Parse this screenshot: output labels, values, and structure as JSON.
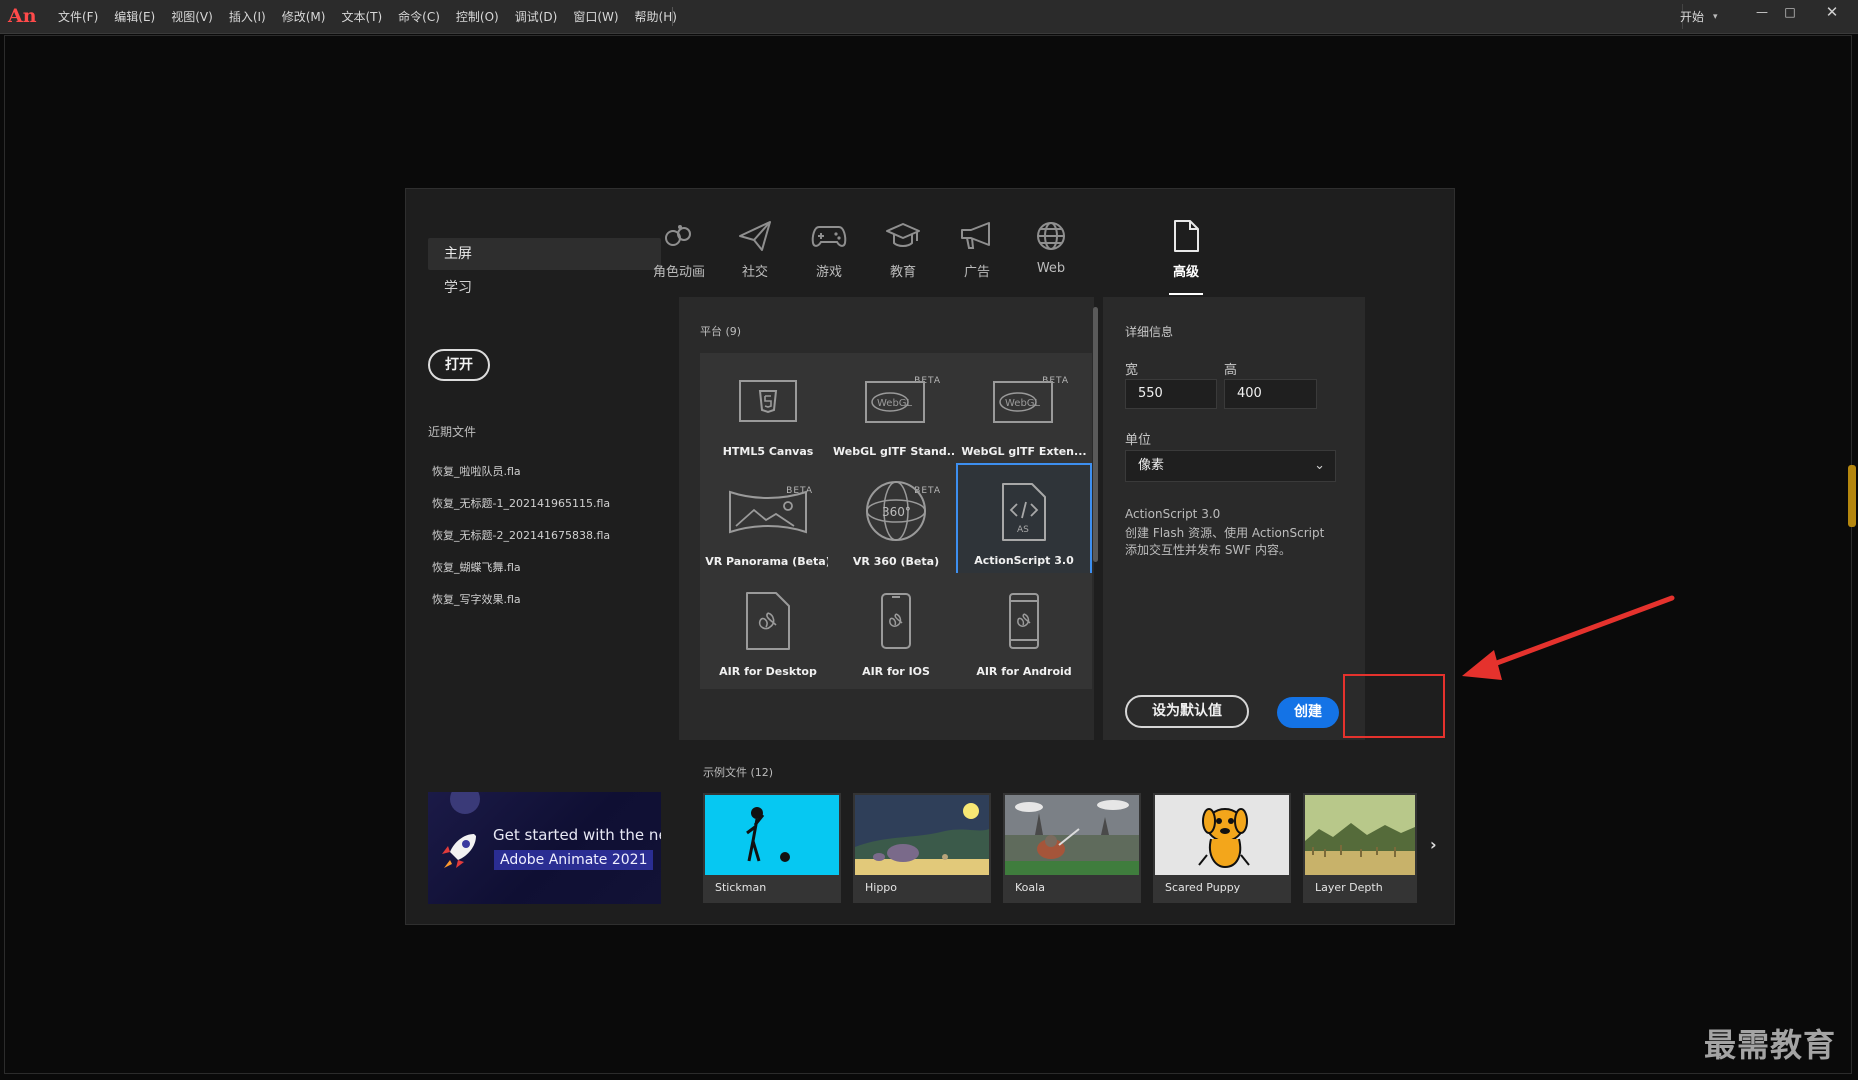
{
  "app": {
    "logo_text": "An",
    "menu": [
      "文件(F)",
      "编辑(E)",
      "视图(V)",
      "插入(I)",
      "修改(M)",
      "文本(T)",
      "命令(C)",
      "控制(O)",
      "调试(D)",
      "窗口(W)",
      "帮助(H)"
    ],
    "workspace_label": "开始",
    "window_buttons": {
      "minimize": "—",
      "maximize": "□",
      "close": "✕"
    }
  },
  "sidebar": {
    "home_label": "主屏",
    "learn_label": "学习",
    "open_label": "打开",
    "recent_title": "近期文件",
    "recent_files": [
      "恢复_啦啦队员.fla",
      "恢复_无标题-1_202141965115.fla",
      "恢复_无标题-2_202141675838.fla",
      "恢复_蝴蝶飞舞.fla",
      "恢复_写字效果.fla"
    ],
    "promo_line1": "Get started with the new",
    "promo_line2": "Adobe Animate 2021"
  },
  "categories": [
    {
      "label": "角色动画",
      "icon": "character-animation-icon",
      "active": false
    },
    {
      "label": "社交",
      "icon": "paper-plane-icon",
      "active": false
    },
    {
      "label": "游戏",
      "icon": "gamepad-icon",
      "active": false
    },
    {
      "label": "教育",
      "icon": "graduation-cap-icon",
      "active": false
    },
    {
      "label": "广告",
      "icon": "megaphone-icon",
      "active": false
    },
    {
      "label": "Web",
      "icon": "globe-icon",
      "active": false
    },
    {
      "label": "高级",
      "icon": "document-icon",
      "active": true
    }
  ],
  "platforms": {
    "heading": "平台 (9)",
    "items": [
      {
        "label": "HTML5 Canvas",
        "icon": "html5-icon",
        "beta": "",
        "selected": false
      },
      {
        "label": "WebGL glTF Stand...",
        "icon": "webgl-icon",
        "beta": "BETA",
        "selected": false
      },
      {
        "label": "WebGL glTF Exten...",
        "icon": "webgl-icon",
        "beta": "BETA",
        "selected": false
      },
      {
        "label": "VR Panorama (Beta)",
        "icon": "vr-panorama-icon",
        "beta": "BETA",
        "selected": false
      },
      {
        "label": "VR 360 (Beta)",
        "icon": "vr-360-icon",
        "beta": "BETA",
        "selected": false
      },
      {
        "label": "ActionScript 3.0",
        "icon": "actionscript-icon",
        "beta": "",
        "selected": true
      },
      {
        "label": "AIR for Desktop",
        "icon": "air-desktop-icon",
        "beta": "",
        "selected": false
      },
      {
        "label": "AIR for IOS",
        "icon": "air-ios-icon",
        "beta": "",
        "selected": false
      },
      {
        "label": "AIR for Android",
        "icon": "air-android-icon",
        "beta": "",
        "selected": false
      }
    ]
  },
  "details": {
    "heading": "详细信息",
    "width_label": "宽",
    "width_value": "550",
    "height_label": "高",
    "height_value": "400",
    "unit_label": "单位",
    "unit_value": "像素",
    "desc_title": "ActionScript 3.0",
    "desc_text": "创建 Flash 资源、使用 ActionScript 添加交互性并发布 SWF 内容。",
    "set_default_label": "设为默认值",
    "create_label": "创建",
    "accent_color": "#1473e6"
  },
  "samples": {
    "heading": "示例文件 (12)",
    "items": [
      "Stickman",
      "Hippo",
      "Koala",
      "Scared Puppy",
      "Layer Depth"
    ],
    "next_icon": "›"
  },
  "annotation": {
    "highlight_color": "#e5322d",
    "watermark": "最需教育"
  }
}
